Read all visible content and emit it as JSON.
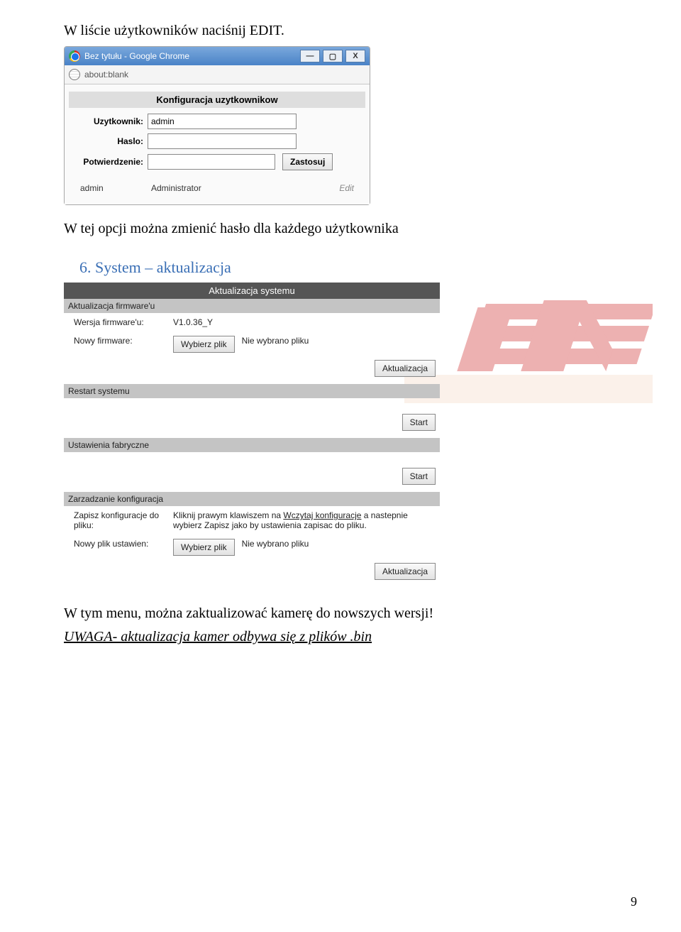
{
  "doc": {
    "intro": "W liście użytkowników naciśnij EDIT.",
    "after_window": "W tej opcji można zmienić hasło dla każdego użytkownika",
    "heading6": "6. System – aktualizacja",
    "summary": "W tym menu, można zaktualizować kamerę do nowszych wersji!",
    "note": "UWAGA- aktualizacja kamer odbywa się z plików .bin",
    "page_number": "9"
  },
  "chrome": {
    "title": "Bez tytułu - Google Chrome",
    "url": "about:blank",
    "wbtn_min": "—",
    "wbtn_max": "▢",
    "wbtn_close": "X",
    "panel_title": "Konfiguracja uzytkownikow",
    "form": {
      "user_lbl": "Uzytkownik:",
      "user_val": "admin",
      "pass_lbl": "Haslo:",
      "confirm_lbl": "Potwierdzenie:",
      "apply": "Zastosuj"
    },
    "row": {
      "user": "admin",
      "role": "Administrator",
      "edit": "Edit"
    }
  },
  "sys": {
    "title": "Aktualizacja systemu",
    "firmware_hdr": "Aktualizacja firmware'u",
    "fw_ver_lbl": "Wersja firmware'u:",
    "fw_ver_val": "V1.0.36_Y",
    "fw_new_lbl": "Nowy firmware:",
    "choose_file": "Wybierz plik",
    "no_file": "Nie wybrano pliku",
    "update_btn": "Aktualizacja",
    "restart_hdr": "Restart systemu",
    "start_btn": "Start",
    "factory_hdr": "Ustawienia fabryczne",
    "config_hdr": "Zarzadzanie konfiguracja",
    "save_cfg_lbl": "Zapisz konfiguracje do pliku:",
    "save_cfg_txt1": "Kliknij prawym klawiszem na ",
    "save_cfg_link": "Wczytaj konfiguracje",
    "save_cfg_txt2": " a nastepnie wybierz Zapisz jako by ustawienia zapisac do pliku.",
    "new_cfg_lbl": "Nowy plik ustawien:"
  }
}
